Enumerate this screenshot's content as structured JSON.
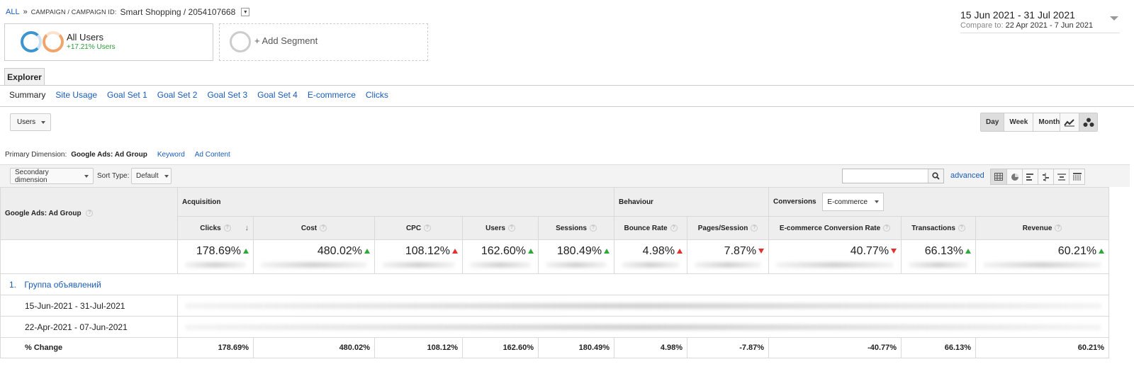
{
  "breadcrumb": {
    "all": "ALL",
    "sep": "»",
    "path": "CAMPAIGN / CAMPAIGN ID:",
    "value": "Smart Shopping / 2054107668"
  },
  "date_range": {
    "main": "15 Jun 2021 - 31 Jul 2021",
    "compare_label": "Compare to:",
    "compare_value": "22 Apr 2021 - 7 Jun 2021"
  },
  "segments": {
    "all_users": "All Users",
    "all_users_pct": "+17.21% Users",
    "add_segment": "+ Add Segment"
  },
  "explorer_tab": "Explorer",
  "subtabs": [
    "Summary",
    "Site Usage",
    "Goal Set 1",
    "Goal Set 2",
    "Goal Set 3",
    "Goal Set 4",
    "E-commerce",
    "Clicks"
  ],
  "metric_select": "Users",
  "period_buttons": [
    "Day",
    "Week",
    "Month"
  ],
  "primary_dimension": {
    "label": "Primary Dimension:",
    "current": "Google Ads: Ad Group",
    "options": [
      "Keyword",
      "Ad Content"
    ]
  },
  "toolbar": {
    "secondary_dimension": "Secondary dimension",
    "sort_type_label": "Sort Type:",
    "sort_type_value": "Default",
    "advanced": "advanced"
  },
  "table": {
    "dimension_header": "Google Ads: Ad Group",
    "groups": {
      "acquisition": "Acquisition",
      "behaviour": "Behaviour",
      "conversions": "Conversions",
      "conversions_select": "E-commerce"
    },
    "columns": [
      "Clicks",
      "Cost",
      "CPC",
      "Users",
      "Sessions",
      "Bounce Rate",
      "Pages/Session",
      "E-commerce Conversion Rate",
      "Transactions",
      "Revenue"
    ],
    "summary": [
      "178.69%",
      "480.02%",
      "108.12%",
      "162.60%",
      "180.49%",
      "4.98%",
      "7.87%",
      "40.77%",
      "66.13%",
      "60.21%"
    ],
    "summary_direction": [
      "up",
      "up",
      "up-red",
      "up",
      "up",
      "up-red",
      "down",
      "down",
      "up",
      "up"
    ],
    "rows": {
      "group_index": "1.",
      "group_name": "Группа объявлений",
      "period1": "15-Jun-2021 - 31-Jul-2021",
      "period2": "22-Apr-2021 - 07-Jun-2021",
      "change_label": "% Change",
      "change_values": [
        "178.69%",
        "480.02%",
        "108.12%",
        "162.60%",
        "180.49%",
        "4.98%",
        "-7.87%",
        "-40.77%",
        "66.13%",
        "60.21%"
      ]
    }
  },
  "colors": {
    "link": "#1a5bb8",
    "positive": "#2ea83a",
    "negative": "#e0312f"
  }
}
